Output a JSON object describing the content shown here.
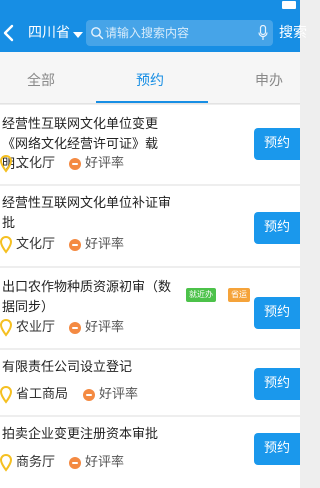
{
  "topbar": {
    "province": "四川省",
    "search_placeholder": "请输入搜索内容",
    "search_button": "搜索"
  },
  "tabs": [
    {
      "label": "全部",
      "active": false
    },
    {
      "label": "预约",
      "active": true
    },
    {
      "label": "申办",
      "active": false
    }
  ],
  "items": [
    {
      "title": "经营性互联网文化单位变更《网络文化经营许可证》载明...",
      "dept": "文化厅",
      "rate": "好评率",
      "action": "预约"
    },
    {
      "title": "经营性互联网文化单位补证审批",
      "dept": "文化厅",
      "rate": "好评率",
      "action": "预约"
    },
    {
      "title": "出口农作物种质资源初审（数据同步）",
      "dept": "农业厅",
      "rate": "好评率",
      "action": "预约",
      "badges": [
        "就近办",
        "省运行"
      ]
    },
    {
      "title": "有限责任公司设立登记",
      "dept": "省工商局",
      "rate": "好评率",
      "action": "预约"
    },
    {
      "title": "拍卖企业变更注册资本审批",
      "dept": "商务厅",
      "rate": "好评率",
      "action": "预约"
    }
  ],
  "colors": {
    "primary": "#178ee4",
    "button": "#1a98ec",
    "pin": "#f5c022",
    "rate_dot": "#f48a42",
    "badge_green": "#4cc24a",
    "badge_orange": "#f5a33a"
  }
}
